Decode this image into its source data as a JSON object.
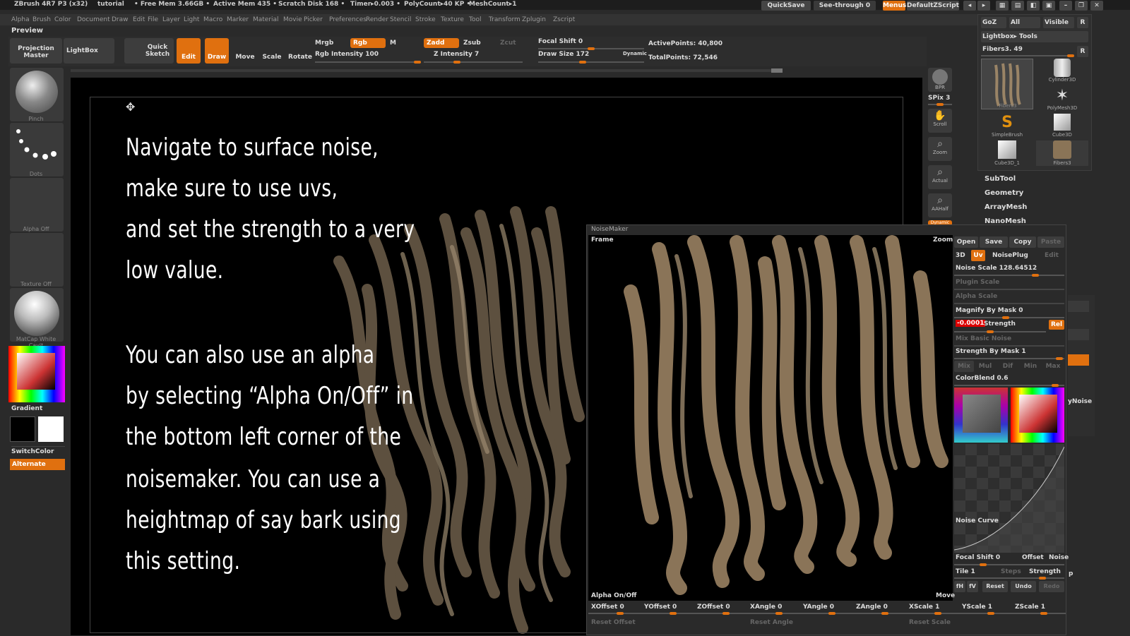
{
  "titlebar": {
    "app": "ZBrush 4R7 P3 (x32)",
    "doc": "tutorial",
    "free_mem": "• Free Mem 3.66GB •",
    "active_mem": "Active Mem 435 •",
    "scratch": "Scratch Disk 168 •",
    "timer": "Timer▸0.003 •",
    "polycount": "PolyCount▸40 KP •",
    "meshcount": "MeshCount▸1",
    "quicksave": "QuickSave",
    "seethrough": "See-through  0",
    "menus": "Menus",
    "zscript": "DefaultZScript"
  },
  "menubar": [
    "Alpha",
    "Brush",
    "Color",
    "Document",
    "Draw",
    "Edit",
    "File",
    "Layer",
    "Light",
    "Macro",
    "Marker",
    "Material",
    "Movie",
    "Picker",
    "Preferences",
    "Render",
    "Stencil",
    "Stroke",
    "Texture",
    "Tool",
    "Transform",
    "Zplugin",
    "Zscript"
  ],
  "preview_label": "Preview",
  "toolbar": {
    "projection_master": "Projection Master",
    "lightbox": "LightBox",
    "quick_sketch": "Quick Sketch",
    "edit": "Edit",
    "draw": "Draw",
    "move": "Move",
    "scale": "Scale",
    "rotate": "Rotate",
    "mrgb": "Mrgb",
    "rgb": "Rgb",
    "m": "M",
    "rgb_intensity": "Rgb Intensity 100",
    "zadd": "Zadd",
    "zsub": "Zsub",
    "zcut": "Zcut",
    "z_intensity": "Z Intensity 7",
    "focal_shift": "Focal Shift 0",
    "draw_size": "Draw Size 172",
    "dynamic": "Dynamic",
    "active_points": "ActivePoints: 40,800",
    "total_points": "TotalPoints: 72,546"
  },
  "leftshelf": {
    "pinch": "Pinch",
    "dots": "Dots",
    "alpha_off": "Alpha  Off",
    "texture_off": "Texture  Off",
    "matcap": "MatCap  White  Cavit",
    "gradient": "Gradient",
    "switchcolor": "SwitchColor",
    "alternate": "Alternate"
  },
  "instructions": {
    "para1": [
      "Navigate to surface noise,",
      "make sure to use uvs,",
      "and set the strength to a very",
      "low value."
    ],
    "para2": [
      "You can also use an alpha",
      "by selecting “Alpha On/Off” in",
      "the bottom left corner of the",
      "noisemaker. You can use a",
      "heightmap of say bark using",
      "this setting."
    ]
  },
  "rightnav": {
    "bpr": "BPR",
    "spix": "SPix 3",
    "scroll": "Scroll",
    "zoom": "Zoom",
    "actual": "Actual",
    "aahalf": "AAHalf",
    "dynamic": "Dynamic"
  },
  "toolpanel": {
    "goz": "GoZ",
    "all": "All",
    "visible": "Visible",
    "r": "R",
    "lightbox_tools": "Lightbox▸ Tools",
    "current_tool": "Fibers3. 49",
    "r2": "R",
    "thumbs": [
      "Fibers3",
      "Cylinder3D",
      "PolyMesh3D",
      "SimpleBrush",
      "Cube3D",
      "Cube3D_1",
      "Fibers3"
    ]
  },
  "menuitems": [
    "SubTool",
    "Geometry",
    "ArrayMesh",
    "NanoMesh"
  ],
  "noisemaker": {
    "title": "NoiseMaker",
    "frame": "Frame",
    "zoom": "Zoom",
    "alpha_onoff": "Alpha On/Off",
    "move": "Move",
    "open": "Open",
    "save": "Save",
    "copy": "Copy",
    "paste": "Paste",
    "three_d": "3D",
    "uv": "Uv",
    "noiseplug": "NoisePlug",
    "edit": "Edit",
    "noise_scale": "Noise Scale  128.64512",
    "plugin_scale": "Plugin Scale",
    "alpha_scale": "Alpha Scale",
    "magnify_by_mask": "Magnify By Mask 0",
    "strength_value": "-0.0001",
    "strength": "Strength",
    "rel": "Rel",
    "mix_basic_noise": "Mix Basic Noise",
    "strength_by_mask": "Strength By Mask 1",
    "mix_modes": [
      "Mix",
      "Mul",
      "Dif",
      "Min",
      "Max"
    ],
    "colorblend": "ColorBlend 0.6",
    "noise_curve": "Noise Curve",
    "focal_shift": "Focal  Shift 0",
    "offset": "Offset",
    "noise": "Noise",
    "tile": "Tile 1",
    "steps": "Steps",
    "strength2": "Strength",
    "fh": "fH",
    "fv": "fV",
    "reset": "Reset",
    "undo": "Undo",
    "redo": "Redo",
    "xoffset": "XOffset 0",
    "yoffset": "YOffset 0",
    "zoffset": "ZOffset 0",
    "xangle": "XAngle 0",
    "yangle": "YAngle 0",
    "zangle": "ZAngle 0",
    "xscale": "XScale 1",
    "yscale": "YScale 1",
    "zscale": "ZScale 1",
    "reset_offset": "Reset Offset",
    "reset_angle": "Reset Angle",
    "reset_scale": "Reset Scale"
  },
  "rightedge": {
    "ynoise": "yNoise",
    "p": "p"
  },
  "colors": {
    "accent": "#e0700f",
    "canvas": "#000000",
    "panel": "#2a2a2a"
  }
}
